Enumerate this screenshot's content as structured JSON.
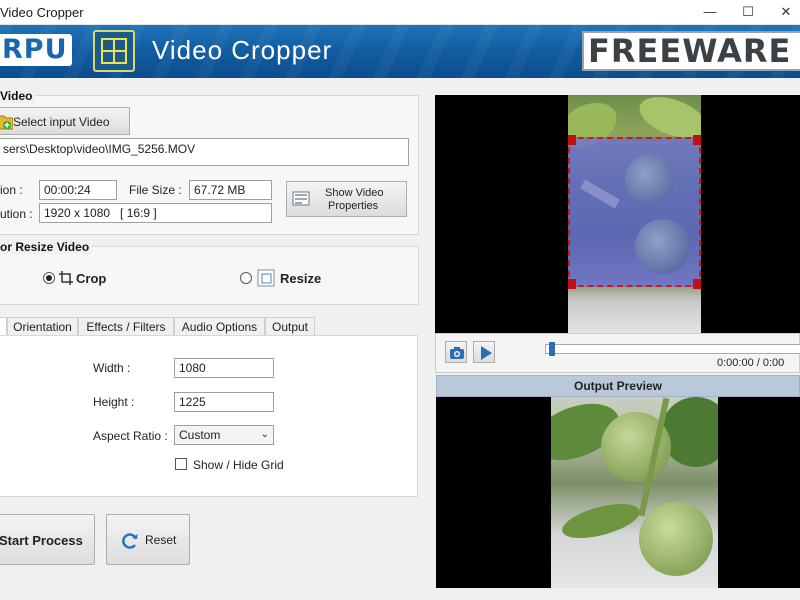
{
  "window": {
    "title": "Video Cropper",
    "minimize_glyph": "—",
    "maximize_glyph": "☐"
  },
  "banner": {
    "logo_text": "RPU",
    "app_title": "Video Cropper",
    "badge": "FREEWARE"
  },
  "input_section": {
    "title": "Video",
    "select_button": "Select input Video",
    "path": "sers\\Desktop\\video\\IMG_5256.MOV",
    "duration_label": "ion :",
    "duration_value": "00:00:24",
    "filesize_label": "File Size :",
    "filesize_value": "67.72 MB",
    "resolution_label": "ution :",
    "resolution_value": "1920 x 1080   [ 16:9 ]",
    "properties_button": [
      "Show Video",
      "Properties"
    ]
  },
  "mode_section": {
    "title": "or Resize Video",
    "crop_label": "Crop",
    "resize_label": "Resize",
    "selected": "crop"
  },
  "tabs": [
    "Orientation",
    "Effects / Filters",
    "Audio Options",
    "Output"
  ],
  "crop_settings": {
    "width_label": "Width :",
    "width_value": "1080",
    "height_label": "Height :",
    "height_value": "1225",
    "aspect_label": "Aspect Ratio :",
    "aspect_value": "Custom",
    "grid_label": "Show / Hide Grid"
  },
  "actions": {
    "start": "Start Process",
    "reset": "Reset"
  },
  "player": {
    "time": "0:00:00 / 0:00",
    "progress": 0.0
  },
  "output_preview": {
    "title": "Output Preview"
  },
  "colors": {
    "banner": "#125ea3",
    "crop_overlay": "#6a70d8",
    "crop_handle": "#d01818"
  }
}
